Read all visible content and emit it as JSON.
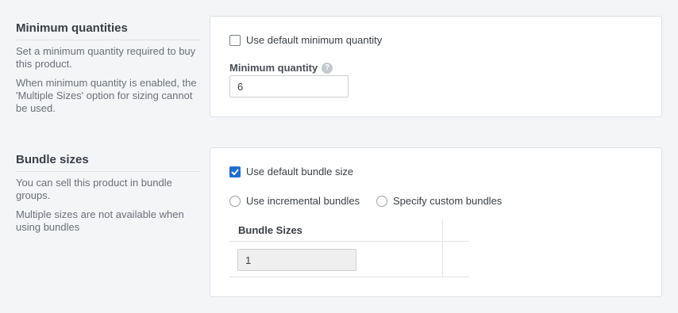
{
  "min_quantities": {
    "title": "Minimum quantities",
    "desc1": "Set a minimum quantity required to buy this product.",
    "desc2": "When minimum quantity is enabled, the 'Multiple Sizes' option for sizing cannot be used.",
    "use_default_label": "Use default minimum quantity",
    "use_default_checked": false,
    "field_label": "Minimum quantity",
    "field_value": "6",
    "help_icon": "question-mark-icon"
  },
  "bundle_sizes": {
    "title": "Bundle sizes",
    "desc1": "You can sell this product in bundle groups.",
    "desc2": "Multiple sizes are not available when using bundles",
    "use_default_label": "Use default bundle size",
    "use_default_checked": true,
    "radio_incremental_label": "Use incremental bundles",
    "radio_custom_label": "Specify custom bundles",
    "table_header": "Bundle Sizes",
    "bundle_value": "1"
  },
  "colors": {
    "accent": "#1f6fd1",
    "background": "#f4f5f7"
  }
}
